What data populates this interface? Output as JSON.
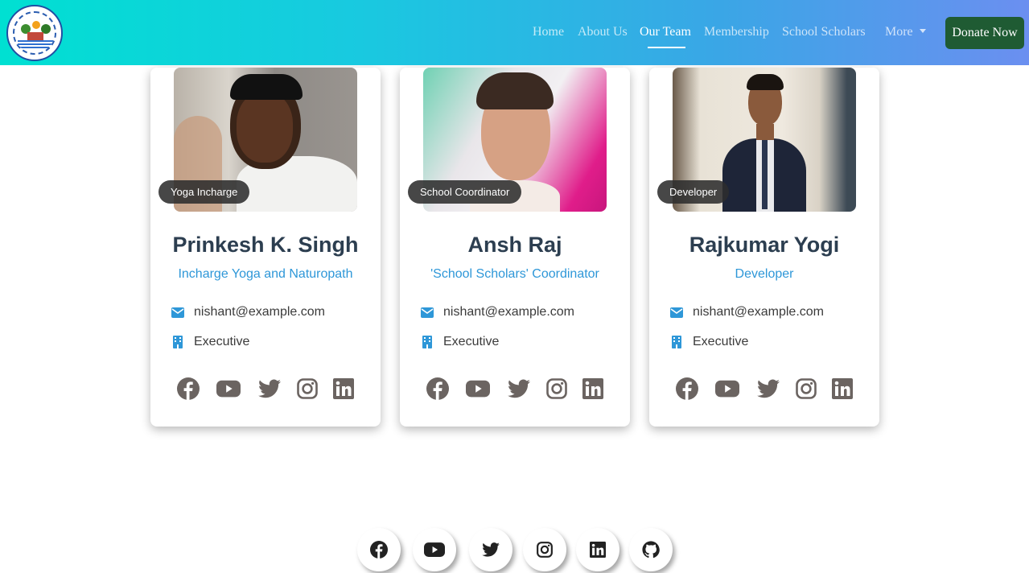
{
  "nav": {
    "links": [
      "Home",
      "About Us",
      "Our Team",
      "Membership",
      "School Scholars",
      "More"
    ],
    "active": "Our Team",
    "donate": "Donate Now"
  },
  "team": [
    {
      "name": "Prinkesh K. Singh",
      "role": "Incharge Yoga and Naturopath",
      "badge": "Yoga Incharge",
      "email": "nishant@example.com",
      "department": "Executive"
    },
    {
      "name": "Ansh Raj",
      "role": "'School Scholars' Coordinator",
      "badge": "School Coordinator",
      "email": "nishant@example.com",
      "department": "Executive"
    },
    {
      "name": "Rajkumar Yogi",
      "role": "Developer",
      "badge": "Developer",
      "email": "nishant@example.com",
      "department": "Executive"
    }
  ],
  "card_social_icons": [
    "facebook-icon",
    "youtube-icon",
    "twitter-icon",
    "instagram-icon",
    "linkedin-icon"
  ],
  "footer_social_icons": [
    "facebook-icon",
    "youtube-icon",
    "twitter-icon",
    "instagram-icon",
    "linkedin-icon",
    "github-icon"
  ],
  "colors": {
    "accent": "#2e97d8",
    "donate": "#1f5b33",
    "name": "#2c3e50",
    "icon_grey": "#6b6461"
  }
}
